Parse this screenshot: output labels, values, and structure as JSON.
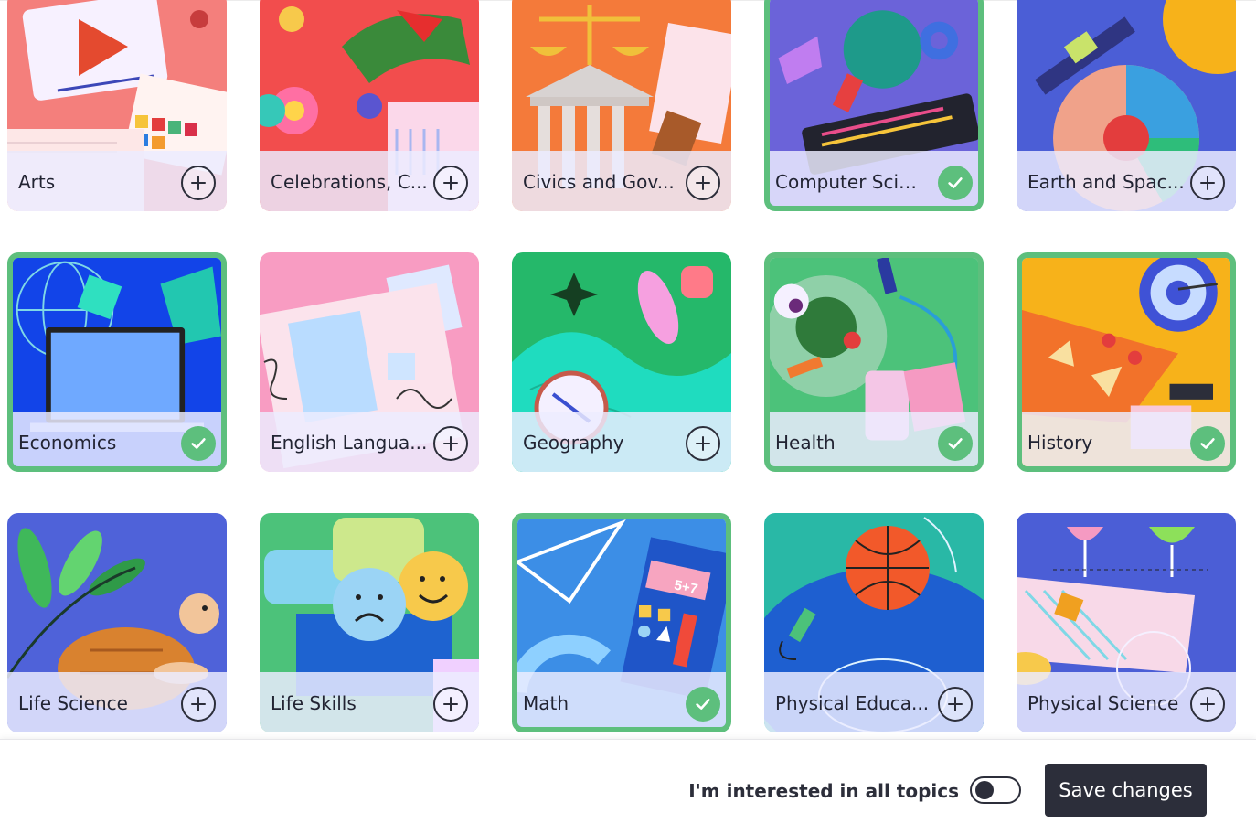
{
  "topics": [
    {
      "label": "Arts",
      "selected": false
    },
    {
      "label": "Celebrations, C...",
      "selected": false
    },
    {
      "label": "Civics and Gov...",
      "selected": false
    },
    {
      "label": "Computer Scie...",
      "selected": true
    },
    {
      "label": "Earth and Spac...",
      "selected": false
    },
    {
      "label": "Economics",
      "selected": true
    },
    {
      "label": "English Langua...",
      "selected": false
    },
    {
      "label": "Geography",
      "selected": false
    },
    {
      "label": "Health",
      "selected": true
    },
    {
      "label": "History",
      "selected": true
    },
    {
      "label": "Life Science",
      "selected": false
    },
    {
      "label": "Life Skills",
      "selected": false
    },
    {
      "label": "Math",
      "selected": true
    },
    {
      "label": "Physical Educa...",
      "selected": false
    },
    {
      "label": "Physical Science",
      "selected": false
    }
  ],
  "footer": {
    "all_topics_label": "I'm interested in all topics",
    "all_topics_enabled": false,
    "save_label": "Save changes"
  },
  "colors": {
    "selected_border": "#5dbf7d",
    "button_dark": "#2c2e3a"
  }
}
